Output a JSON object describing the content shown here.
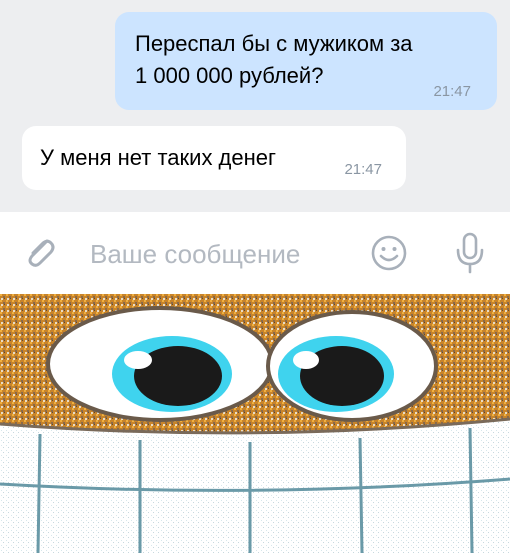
{
  "messages": [
    {
      "direction": "outgoing",
      "lines": [
        "Переспал бы с мужиком за",
        "1 000 000 рублей?"
      ],
      "time": "21:47"
    },
    {
      "direction": "incoming",
      "text": "У меня нет таких денег",
      "time": "21:47"
    }
  ],
  "composer": {
    "placeholder": "Ваше сообщение",
    "icons": {
      "attach": "paperclip-icon",
      "emoji": "smiley-icon",
      "voice": "microphone-icon"
    }
  },
  "meme_image": {
    "description_icon": "grinning-face-image"
  },
  "colors": {
    "chat_background": "#edeef0",
    "outgoing_bubble": "#cce4ff",
    "incoming_bubble": "#ffffff",
    "timestamp": "#8a96a3",
    "placeholder": "#b3b9c1",
    "icon": "#a8b0ba",
    "meme_face": "#c8842a",
    "meme_iris": "#3fd3ee"
  }
}
